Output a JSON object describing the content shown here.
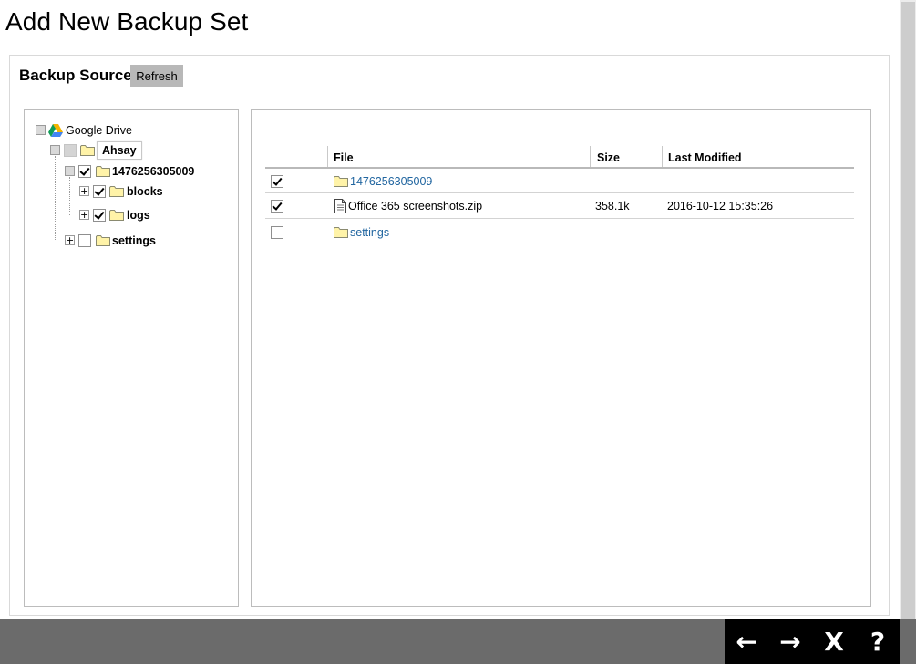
{
  "page": {
    "title": "Add New Backup Set"
  },
  "section": {
    "title": "Backup Source",
    "refresh_label": "Refresh"
  },
  "tree": {
    "root": {
      "label": "Google Drive",
      "icon": "google-drive-icon",
      "expander": "−"
    },
    "account": {
      "label": "Ahsay",
      "expander": "−",
      "checked": "partial"
    },
    "folder_1476256305009": {
      "label": "1476256305009",
      "expander": "−",
      "checked": true
    },
    "folder_blocks": {
      "label": "blocks",
      "expander": "+",
      "checked": true
    },
    "folder_logs": {
      "label": "logs",
      "expander": "+",
      "checked": true
    },
    "folder_settings": {
      "label": "settings",
      "expander": "+",
      "checked": false
    }
  },
  "table": {
    "columns": {
      "file": "File",
      "size": "Size",
      "last_modified": "Last Modified"
    },
    "rows": [
      {
        "name": "1476256305009",
        "type": "folder",
        "checked": true,
        "size": "--",
        "modified": "--"
      },
      {
        "name": "Office 365 screenshots.zip",
        "type": "file",
        "checked": true,
        "size": "358.1k",
        "modified": "2016-10-12 15:35:26"
      },
      {
        "name": "settings",
        "type": "folder",
        "checked": false,
        "size": "--",
        "modified": "--"
      }
    ]
  },
  "nav": {
    "back": "←",
    "next": "→",
    "cancel": "X",
    "help": "?"
  },
  "colors": {
    "link": "#2266a0",
    "bottom_bar": "#6b6b6b",
    "nav_box": "#000000",
    "folder": "#fff3a8"
  }
}
